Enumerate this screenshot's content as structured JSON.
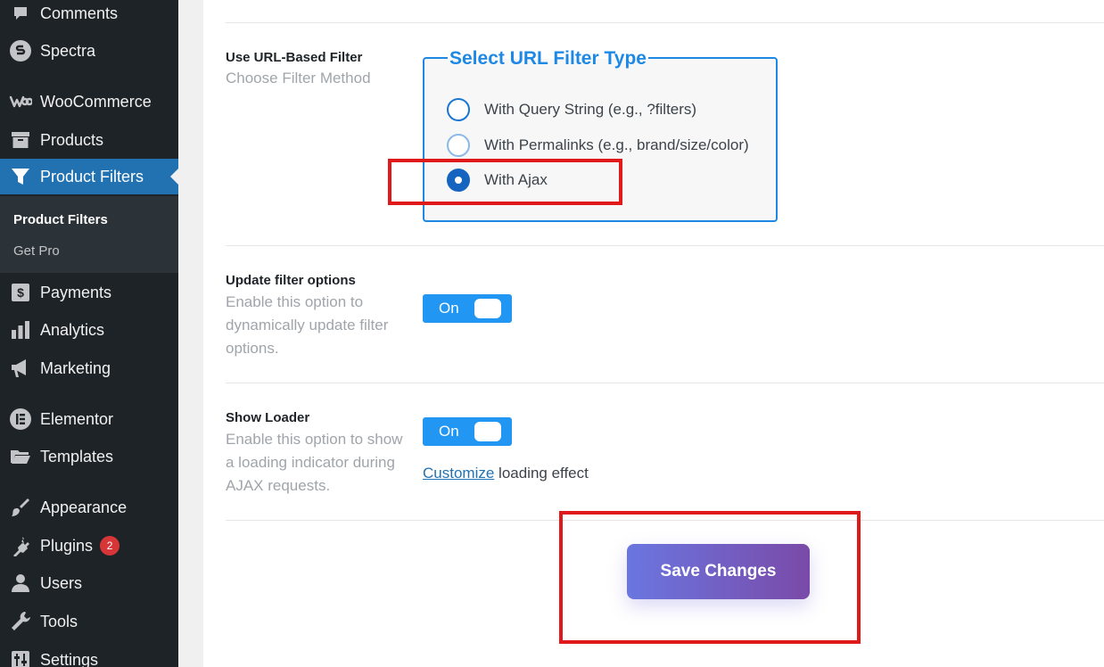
{
  "sidebar": {
    "items": [
      {
        "label": "Comments",
        "icon": "comment-icon"
      },
      {
        "label": "Spectra",
        "icon": "spectra-icon"
      },
      {
        "label": "WooCommerce",
        "icon": "woocommerce-icon"
      },
      {
        "label": "Products",
        "icon": "archive-icon"
      },
      {
        "label": "Product Filters",
        "icon": "filter-icon",
        "active": true
      },
      {
        "label": "Payments",
        "icon": "dollar-icon"
      },
      {
        "label": "Analytics",
        "icon": "bar-chart-icon"
      },
      {
        "label": "Marketing",
        "icon": "megaphone-icon"
      },
      {
        "label": "Elementor",
        "icon": "elementor-icon"
      },
      {
        "label": "Templates",
        "icon": "folder-icon"
      },
      {
        "label": "Appearance",
        "icon": "brush-icon"
      },
      {
        "label": "Plugins",
        "icon": "plug-icon",
        "badge": "2"
      },
      {
        "label": "Users",
        "icon": "user-icon"
      },
      {
        "label": "Tools",
        "icon": "wrench-icon"
      },
      {
        "label": "Settings",
        "icon": "sliders-icon"
      }
    ],
    "submenu": [
      {
        "label": "Product Filters",
        "current": true
      },
      {
        "label": "Get Pro"
      }
    ]
  },
  "main": {
    "url_filter": {
      "title": "Use URL-Based Filter",
      "desc": "Choose Filter Method",
      "legend": "Select URL Filter Type",
      "options": [
        {
          "label": "With Query String (e.g., ?filters)",
          "checked": false
        },
        {
          "label": "With Permalinks (e.g., brand/size/color)",
          "checked": false
        },
        {
          "label": "With Ajax",
          "checked": true
        }
      ]
    },
    "update_options": {
      "title": "Update filter options",
      "desc": "Enable this option to dynamically update filter options.",
      "toggle": "On"
    },
    "show_loader": {
      "title": "Show Loader",
      "desc": "Enable this option to show a loading indicator during AJAX requests.",
      "toggle": "On",
      "customize_link": "Customize",
      "customize_suffix": " loading effect"
    },
    "save_label": "Save Changes"
  },
  "colors": {
    "sidebar_bg": "#1d2327",
    "accent": "#2271b1",
    "toggle": "#2196f3",
    "legend": "#1e88e5",
    "highlight": "#e0191b"
  }
}
